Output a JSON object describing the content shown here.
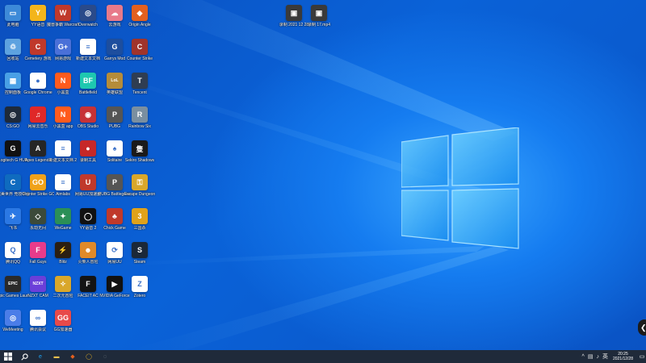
{
  "desktop": {
    "icons": [
      {
        "label": "此电脑",
        "color": "#3d8ad8",
        "glyph": "▭"
      },
      {
        "label": "YY语音",
        "color": "#f3b51b",
        "glyph": "Y"
      },
      {
        "label": "魔兽争霸 Warcraft III",
        "color": "#c0392b",
        "glyph": "W"
      },
      {
        "label": "Overwatch",
        "color": "#2a4a8a",
        "glyph": "◎"
      },
      {
        "label": "云游戏",
        "color": "#e87a8a",
        "glyph": "☁"
      },
      {
        "label": "Origin Angle",
        "color": "#e3601f",
        "glyph": "◆"
      },
      {
        "label": "回收站",
        "color": "#5da2e0",
        "glyph": "♲"
      },
      {
        "label": "Cemetery 游戏",
        "color": "#c0392b",
        "glyph": "C"
      },
      {
        "label": "网易游戏",
        "color": "#4a70d8",
        "glyph": "G+"
      },
      {
        "label": "新建文本文档",
        "color": "#ffffff",
        "glyph": "≡"
      },
      {
        "label": "Garrys Mod",
        "color": "#1d4e9e",
        "glyph": "G"
      },
      {
        "label": "Counter Strike",
        "color": "#a0342b",
        "glyph": "C"
      },
      {
        "label": "控制面板",
        "color": "#49a0e6",
        "glyph": "▦"
      },
      {
        "label": "Google Chrome",
        "color": "#ffffff",
        "glyph": "●"
      },
      {
        "label": "小黑盒",
        "color": "#ff5b1d",
        "glyph": "N"
      },
      {
        "label": "Battlefield",
        "color": "#1ec8b0",
        "glyph": "BF"
      },
      {
        "label": "英雄联盟",
        "color": "#b58c3a",
        "glyph": "LoL"
      },
      {
        "label": "Tencent",
        "color": "#2f3d52",
        "glyph": "T"
      },
      {
        "label": "CS:GO",
        "color": "#1e2a3a",
        "glyph": "◎"
      },
      {
        "label": "网易云音乐",
        "color": "#e02828",
        "glyph": "♫"
      },
      {
        "label": "小黑盒 app",
        "color": "#ff5b1d",
        "glyph": "N"
      },
      {
        "label": "OBS Studio",
        "color": "#c73236",
        "glyph": "◉"
      },
      {
        "label": "PUBG",
        "color": "#555555",
        "glyph": "P"
      },
      {
        "label": "Rainbow Six",
        "color": "#7a8fa0",
        "glyph": "R"
      },
      {
        "label": "Logitech G HUB",
        "color": "#111111",
        "glyph": "G"
      },
      {
        "label": "Apex Legends",
        "color": "#262626",
        "glyph": "A"
      },
      {
        "label": "新建文本文档 2",
        "color": "#ffffff",
        "glyph": "≡"
      },
      {
        "label": "录制工具",
        "color": "#c62828",
        "glyph": "●"
      },
      {
        "label": "Solitaire",
        "color": "#ffffff",
        "glyph": "♠"
      },
      {
        "label": "Sekiro Shadows",
        "color": "#1a1a1a",
        "glyph": "隻"
      },
      {
        "label": "完美世界 竞技平台",
        "color": "#0f6bbf",
        "glyph": "C"
      },
      {
        "label": "Counter Strike GO",
        "color": "#f0a21a",
        "glyph": "GO"
      },
      {
        "label": "Aimlabs",
        "color": "#ffffff",
        "glyph": "≡"
      },
      {
        "label": "网易UU加速器",
        "color": "#c0392b",
        "glyph": "U"
      },
      {
        "label": "PUBG Battlegrounds",
        "color": "#555555",
        "glyph": "P"
      },
      {
        "label": "Escape Dungeon",
        "color": "#d9a72a",
        "glyph": "⚿"
      },
      {
        "label": "飞书",
        "color": "#2b78e4",
        "glyph": "✈"
      },
      {
        "label": "永劫无间",
        "color": "#3c4a3a",
        "glyph": "◇"
      },
      {
        "label": "WeGame",
        "color": "#2b8f56",
        "glyph": "✦"
      },
      {
        "label": "YY语音 2",
        "color": "#111111",
        "glyph": "◯"
      },
      {
        "label": "Chick Game",
        "color": "#c0392b",
        "glyph": "♣"
      },
      {
        "label": "三国杀",
        "color": "#e0a21a",
        "glyph": "3"
      },
      {
        "label": "腾讯QQ",
        "color": "#ffffff",
        "glyph": "Q"
      },
      {
        "label": "Fall Guys",
        "color": "#e83b8b",
        "glyph": "F"
      },
      {
        "label": "Blitz",
        "color": "#2b1f12",
        "glyph": "⚡"
      },
      {
        "label": "火柴人冒险",
        "color": "#e08a2a",
        "glyph": "☻"
      },
      {
        "label": "网易UU",
        "color": "#ffffff",
        "glyph": "⟳"
      },
      {
        "label": "Steam",
        "color": "#1b2838",
        "glyph": "S"
      },
      {
        "label": "Epic Games Launcher",
        "color": "#2a2a2a",
        "glyph": "EPIC"
      },
      {
        "label": "NZXT CAM",
        "color": "#6b3fd9",
        "glyph": "NZXT"
      },
      {
        "label": "二次元冒险",
        "color": "#d9a72a",
        "glyph": "✧"
      },
      {
        "label": "FACEIT AC",
        "color": "#141414",
        "glyph": "F"
      },
      {
        "label": "NVIDIA GeForce",
        "color": "#111111",
        "glyph": "▶"
      },
      {
        "label": "Zotero",
        "color": "#ffffff",
        "glyph": "Z"
      },
      {
        "label": "WeMeeting",
        "color": "#4b7de8",
        "glyph": "◎"
      },
      {
        "label": "腾讯会议",
        "color": "#ffffff",
        "glyph": "∞"
      },
      {
        "label": "GG加速器",
        "color": "#e84a4a",
        "glyph": "GG"
      }
    ],
    "top_files": [
      {
        "label": "录制 2021 12 28",
        "color": "#3a3a3a",
        "glyph": "▣"
      },
      {
        "label": "录制 17.mp4",
        "color": "#3a3a3a",
        "glyph": "▣"
      }
    ]
  },
  "taskbar": {
    "start_icon": "windows-start-icon",
    "search_icon": "search-icon",
    "apps": [
      {
        "name": "edge-icon",
        "glyph": "e",
        "color": "#1da1f2"
      },
      {
        "name": "file-explorer-icon",
        "glyph": "▬",
        "color": "#f2c14e"
      },
      {
        "name": "game-app-icon",
        "glyph": "◆",
        "color": "#e3601f"
      },
      {
        "name": "overlay-app-icon",
        "glyph": "◯",
        "color": "#d9a72a"
      },
      {
        "name": "utility-app-icon",
        "glyph": "◌",
        "color": "#9aa0a6"
      }
    ],
    "tray": {
      "chevron": "^",
      "network": "▤",
      "volume": "♪",
      "ime": "英"
    },
    "clock": {
      "time": "20:25",
      "date": "2021/12/28"
    }
  },
  "edge_tab_glyph": "❮"
}
